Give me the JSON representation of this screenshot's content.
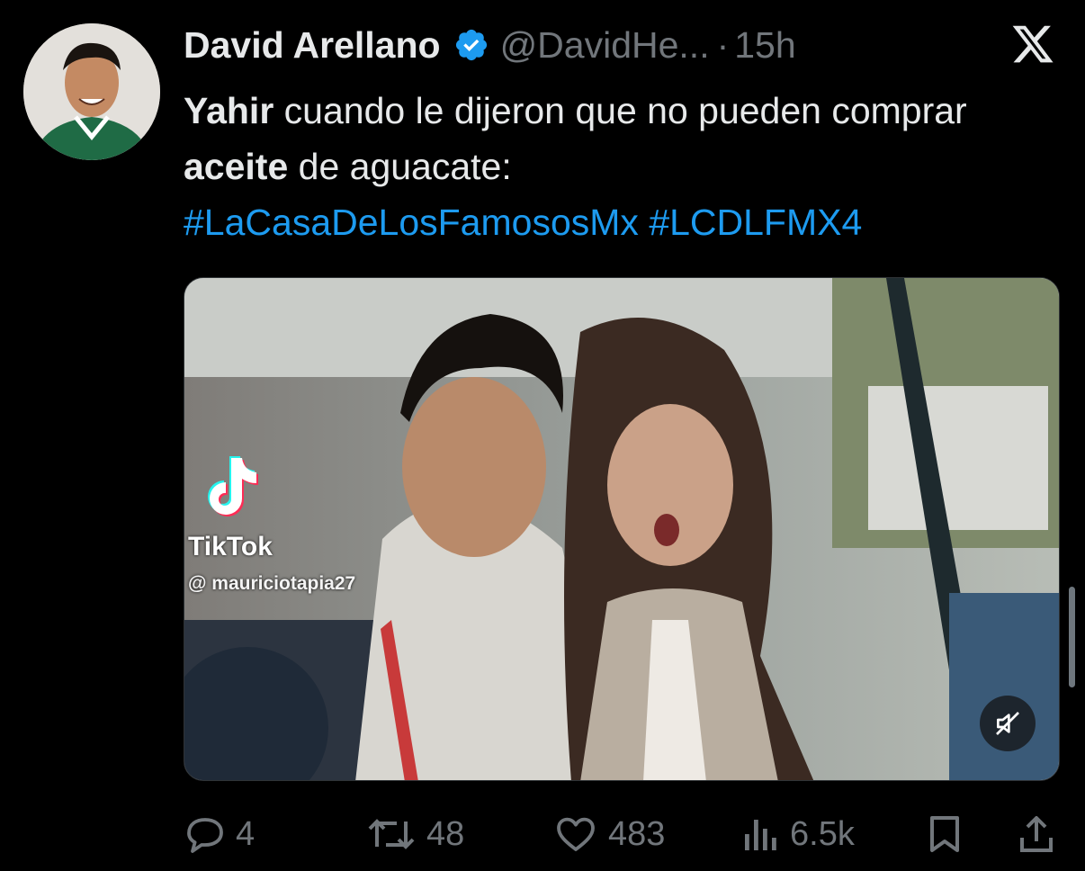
{
  "tweet": {
    "author_name": "David Arellano",
    "handle": "@DavidHe...",
    "separator": "·",
    "time": "15h",
    "text_bold_1": "Yahir",
    "text_1": " cuando le dijeron que no pueden comprar ",
    "text_bold_2": "aceite",
    "text_2": " de aguacate:",
    "hashtag_1": "#LaCasaDeLosFamososMx",
    "hashtag_2": "#LCDLFMX4"
  },
  "media": {
    "watermark_label": "TikTok",
    "watermark_user": "@ mauriciotapia27",
    "mute_icon": "muted-speaker-icon"
  },
  "actions": {
    "replies": "4",
    "reposts": "48",
    "likes": "483",
    "views": "6.5k"
  },
  "colors": {
    "background": "#000000",
    "text": "#e7e9ea",
    "secondary": "#71767b",
    "link": "#1d9bf0",
    "verified": "#1d9bf0"
  }
}
